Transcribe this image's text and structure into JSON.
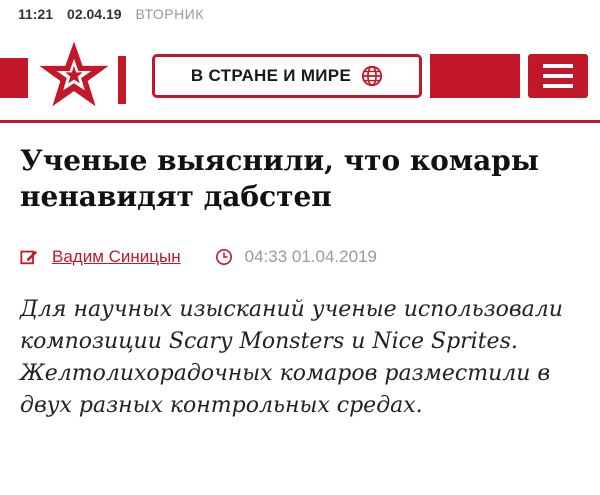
{
  "status_bar": {
    "time": "11:21",
    "date": "02.04.19",
    "weekday": "ВТОРНИК"
  },
  "header": {
    "section_label": "В СТРАНЕ И МИРЕ",
    "logo_icon": "red-star-logo-icon",
    "globe_icon": "globe-icon",
    "menu_icon": "hamburger-menu-icon",
    "brand_color": "#c21829"
  },
  "article": {
    "headline": "Ученые выяснили, что комары ненавидят дабстеп",
    "author": "Вадим Синицын",
    "published": "04:33 01.04.2019",
    "lead": "Для научных изысканий ученые использовали композиции Scary Monsters и Nice Sprites. Желтолихорадочных комаров разместили в двух разных контрольных средах."
  }
}
